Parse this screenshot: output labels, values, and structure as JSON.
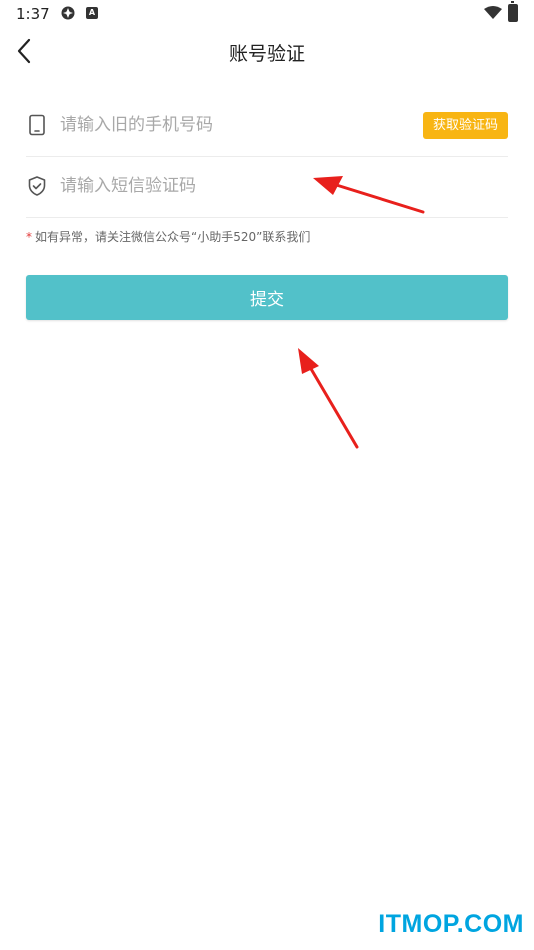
{
  "status_bar": {
    "time": "1:37",
    "icons": [
      "gear-status-icon",
      "a-status-icon",
      "wifi-icon",
      "battery-icon"
    ],
    "badge_letter": "A"
  },
  "header": {
    "title": "账号验证",
    "back_icon": "chevron-left-icon"
  },
  "form": {
    "phone": {
      "placeholder": "请输入旧的手机号码",
      "value": "",
      "icon": "phone-icon"
    },
    "get_code_label": "获取验证码",
    "code": {
      "placeholder": "请输入短信验证码",
      "value": "",
      "icon": "shield-check-icon"
    },
    "notice_star": "*",
    "notice": "如有异常，请关注微信公众号“小助手520”联系我们",
    "submit_label": "提交"
  },
  "colors": {
    "accent": "#52c1c9",
    "code_button": "#f8b513",
    "notice_star": "#e23b3b",
    "annotation_arrow": "#e8201c",
    "watermark": "#00a5e0"
  },
  "watermark": "ITMOP.COM"
}
